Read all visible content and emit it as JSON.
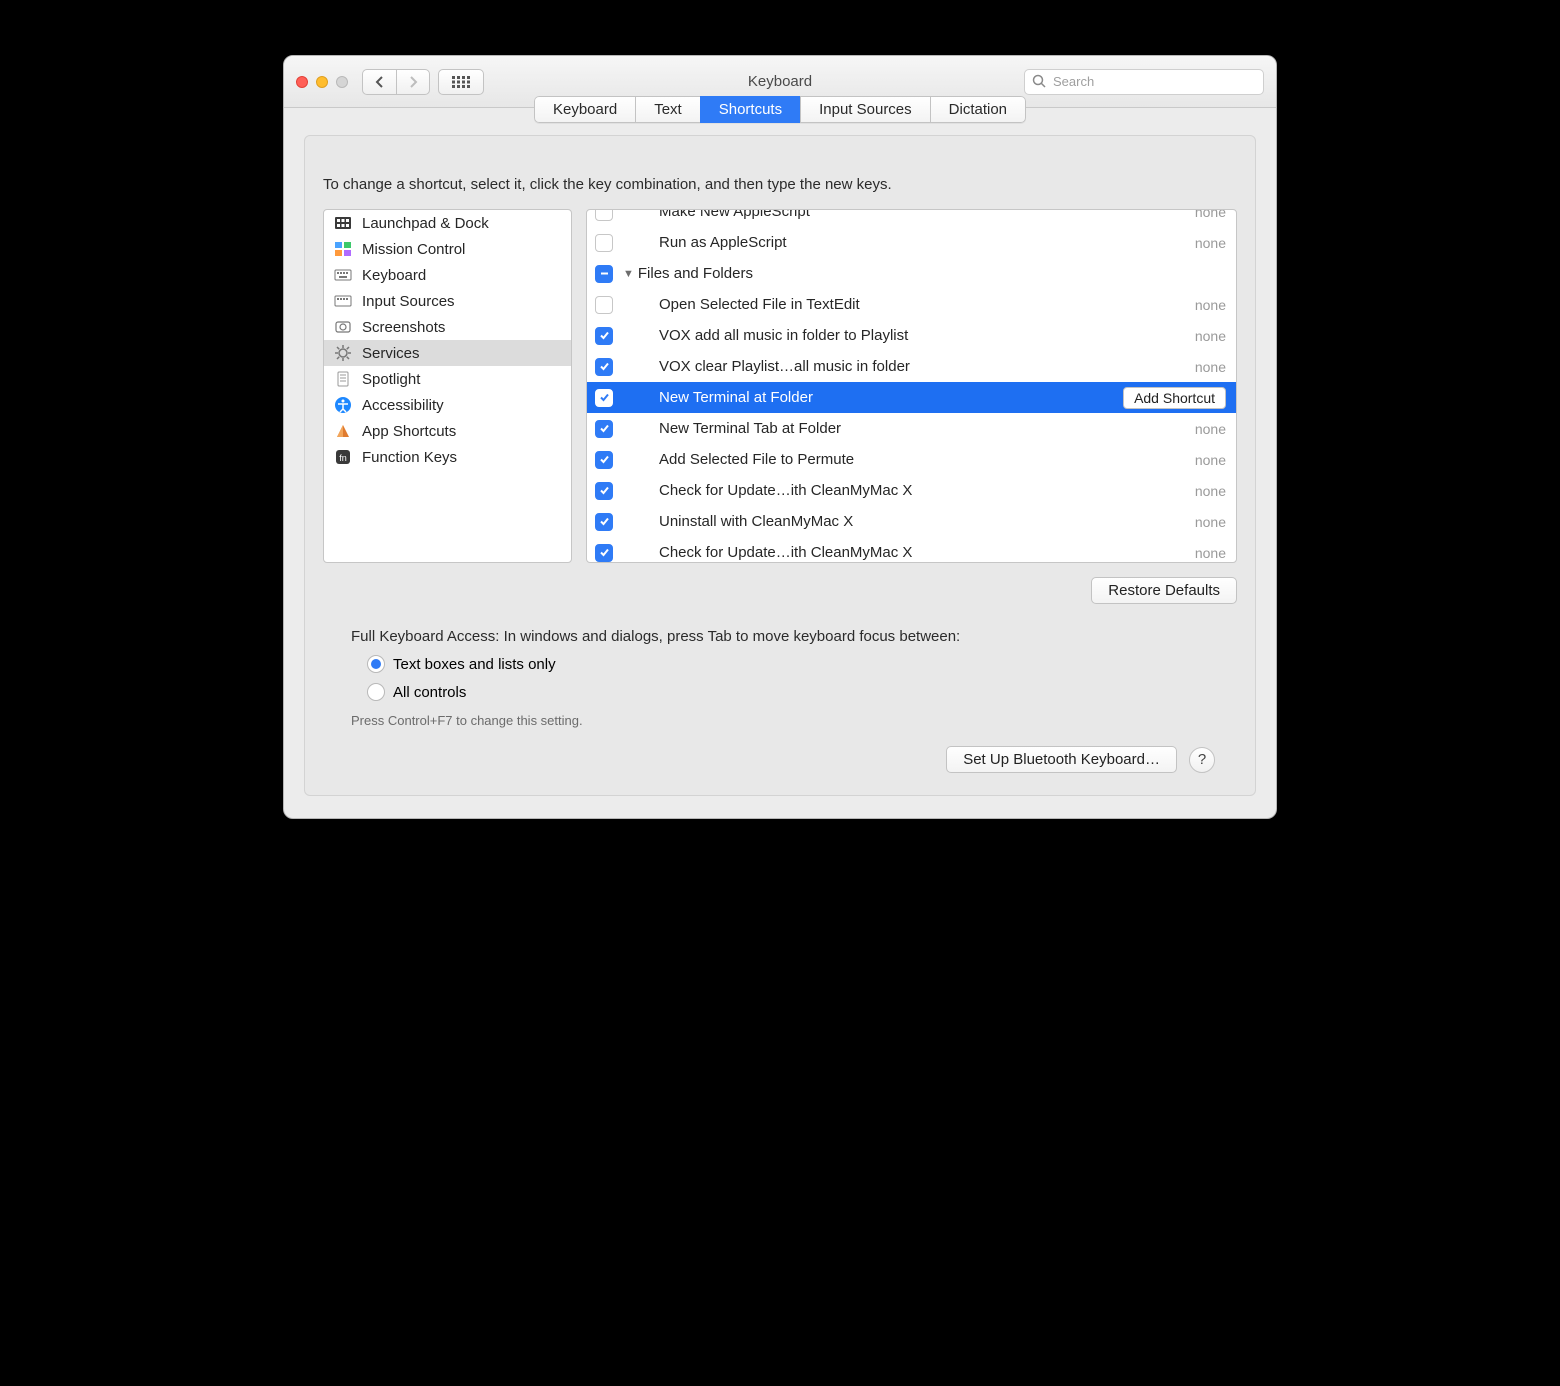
{
  "window": {
    "title": "Keyboard",
    "search_placeholder": "Search"
  },
  "tabs": [
    {
      "label": "Keyboard",
      "active": false
    },
    {
      "label": "Text",
      "active": false
    },
    {
      "label": "Shortcuts",
      "active": true
    },
    {
      "label": "Input Sources",
      "active": false
    },
    {
      "label": "Dictation",
      "active": false
    }
  ],
  "instruction": "To change a shortcut, select it, click the key combination, and then type the new keys.",
  "sidebar": {
    "items": [
      {
        "label": "Launchpad & Dock",
        "icon": "launchpad"
      },
      {
        "label": "Mission Control",
        "icon": "mission"
      },
      {
        "label": "Keyboard",
        "icon": "keyboard"
      },
      {
        "label": "Input Sources",
        "icon": "input"
      },
      {
        "label": "Screenshots",
        "icon": "screenshot"
      },
      {
        "label": "Services",
        "icon": "gear",
        "selected": true
      },
      {
        "label": "Spotlight",
        "icon": "spotlight"
      },
      {
        "label": "Accessibility",
        "icon": "accessibility"
      },
      {
        "label": "App Shortcuts",
        "icon": "app"
      },
      {
        "label": "Function Keys",
        "icon": "fn"
      }
    ]
  },
  "details": {
    "rows": [
      {
        "type": "item",
        "checked": false,
        "label": "Make New AppleScript",
        "value": "none",
        "cut": true
      },
      {
        "type": "item",
        "checked": false,
        "label": "Run as AppleScript",
        "value": "none"
      },
      {
        "type": "group",
        "checked": "mixed",
        "label": "Files and Folders"
      },
      {
        "type": "item",
        "checked": false,
        "label": "Open Selected File in TextEdit",
        "value": "none"
      },
      {
        "type": "item",
        "checked": true,
        "label": "VOX add all music in folder to Playlist",
        "value": "none"
      },
      {
        "type": "item",
        "checked": true,
        "label": "VOX clear Playlist…all music in folder",
        "value": "none"
      },
      {
        "type": "item",
        "checked": true,
        "label": "New Terminal at Folder",
        "value": "add_shortcut",
        "selected": true
      },
      {
        "type": "item",
        "checked": true,
        "label": "New Terminal Tab at Folder",
        "value": "none"
      },
      {
        "type": "item",
        "checked": true,
        "label": "Add Selected File to Permute",
        "value": "none"
      },
      {
        "type": "item",
        "checked": true,
        "label": "Check for Update…ith CleanMyMac X",
        "value": "none"
      },
      {
        "type": "item",
        "checked": true,
        "label": "Uninstall with CleanMyMac X",
        "value": "none"
      },
      {
        "type": "item",
        "checked": true,
        "label": "Check for Update…ith CleanMyMac X",
        "value": "none",
        "cutBottom": true
      }
    ],
    "add_shortcut_label": "Add Shortcut",
    "none_label": "none"
  },
  "restore_defaults": "Restore Defaults",
  "fka": {
    "label": "Full Keyboard Access: In windows and dialogs, press Tab to move keyboard focus between:",
    "options": [
      {
        "label": "Text boxes and lists only",
        "checked": true
      },
      {
        "label": "All controls",
        "checked": false
      }
    ],
    "hint": "Press Control+F7 to change this setting."
  },
  "footer": {
    "bluetooth": "Set Up Bluetooth Keyboard…"
  }
}
